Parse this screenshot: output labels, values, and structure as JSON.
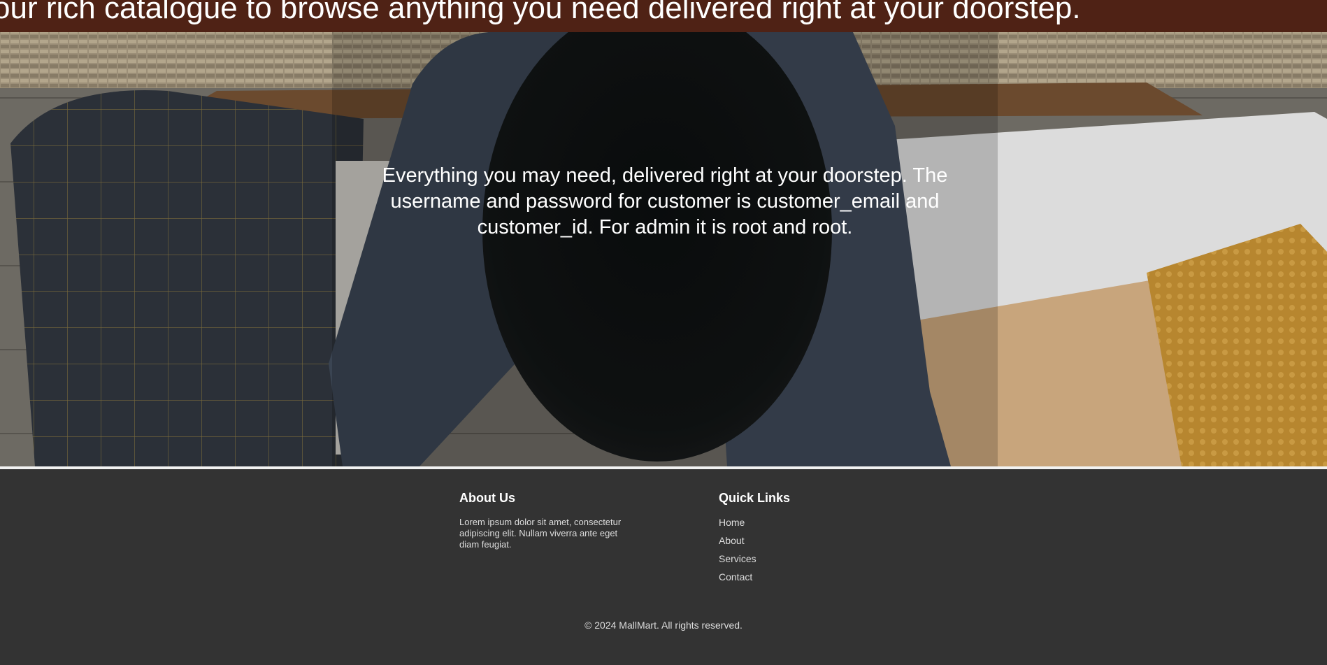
{
  "hero": {
    "marquee_text": "our rich catalogue to browse anything you need delivered right at your doorstep.",
    "message": "Everything you may need, delivered right at your doorstep. The username and password for customer is customer_email and customer_id. For admin it is root and root."
  },
  "footer": {
    "about": {
      "heading": "About Us",
      "text": "Lorem ipsum dolor sit amet, consectetur adipiscing elit. Nullam viverra ante eget diam feugiat."
    },
    "quick_links": {
      "heading": "Quick Links",
      "items": [
        "Home",
        "About",
        "Services",
        "Contact"
      ]
    },
    "copyright": "© 2024 MallMart. All rights reserved."
  },
  "colors": {
    "marquee_band": "#4f2215",
    "footer_bg": "#333333",
    "text_light": "#ffffff"
  }
}
